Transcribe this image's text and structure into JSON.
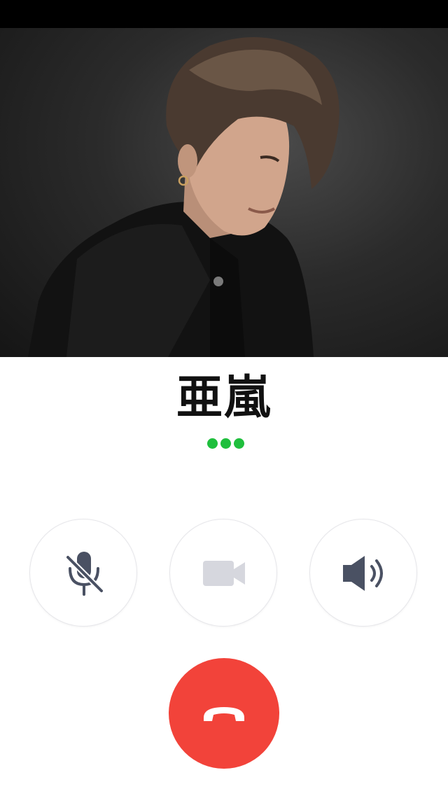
{
  "call": {
    "caller_name": "亜嵐",
    "status": "calling",
    "status_indicator_color": "#1fbf3d"
  },
  "controls": {
    "mute": {
      "icon": "microphone-off-icon",
      "state": "muted"
    },
    "video": {
      "icon": "video-camera-icon",
      "state": "disabled"
    },
    "speaker": {
      "icon": "speaker-icon",
      "state": "on"
    },
    "end_call": {
      "icon": "phone-hangup-icon",
      "color": "#f2433a"
    }
  },
  "colors": {
    "icon_dark": "#4a5163",
    "icon_disabled": "#d6d7de",
    "button_border": "#e6e6ea"
  }
}
